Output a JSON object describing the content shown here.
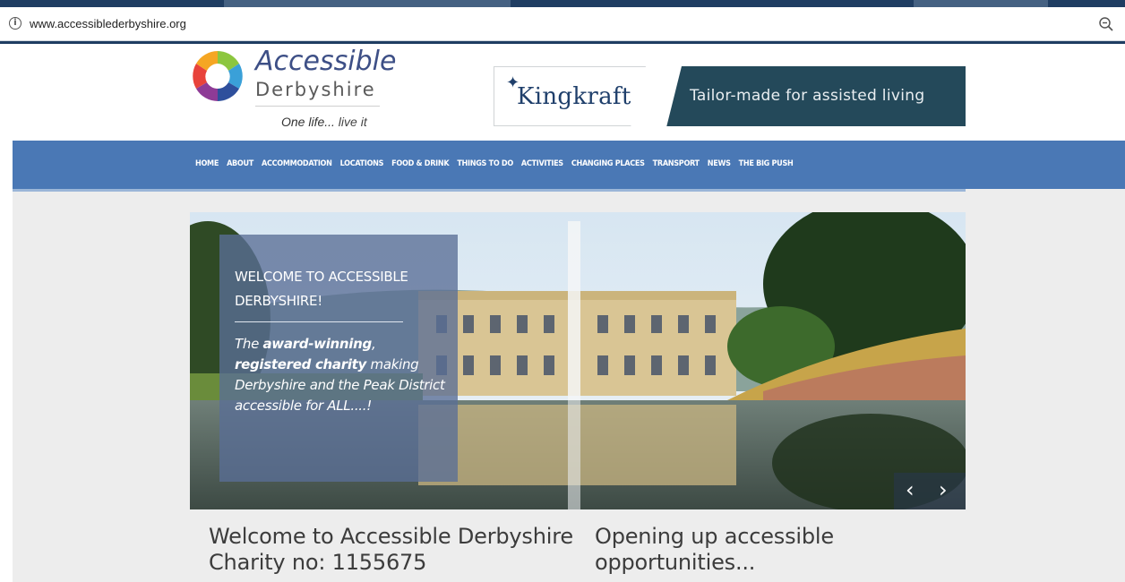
{
  "browser": {
    "url": "www.accessiblederbyshire.org",
    "info_icon": "info-circle-icon",
    "zoom_icon": "zoom-out-icon"
  },
  "logo": {
    "line1": "Accessible",
    "line2": "Derbyshire",
    "tagline_part1": "One life...",
    "tagline_part2": " live it",
    "mark_icon": "multicolour-ring-logo-icon"
  },
  "ad": {
    "brand": "Kingkraft",
    "tagline": "Tailor-made for assisted living",
    "colors": {
      "panel": "#24495a",
      "brand_text": "#1f3f6b"
    }
  },
  "nav": {
    "items": [
      "HOME",
      "ABOUT",
      "ACCOMMODATION",
      "LOCATIONS",
      "FOOD & DRINK",
      "THINGS TO DO",
      "ACTIVITIES",
      "CHANGING PLACES",
      "TRANSPORT",
      "NEWS",
      "THE BIG PUSH"
    ],
    "background": "#4a78b5"
  },
  "slider": {
    "heading": "WELCOME TO ACCESSIBLE DERBYSHIRE!",
    "desc_lead": "The ",
    "desc_bold1": "award-winning",
    "desc_comma": ",",
    "desc_bold2": "registered charity",
    "desc_rest": " making Derbyshire and the Peak District accessible for ALL....!",
    "prev_label": "‹",
    "next_label": "›"
  },
  "main": {
    "left_heading_line1": "Welcome to Accessible Derbyshire",
    "left_heading_line2": "Charity no: 1155675",
    "right_heading_line1": "Opening up accessible",
    "right_heading_line2": "opportunities..."
  }
}
